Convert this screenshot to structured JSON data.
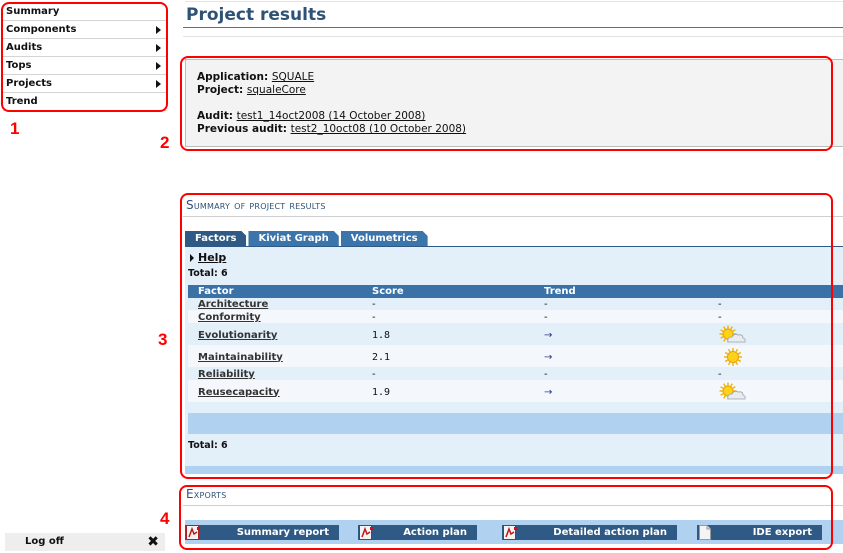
{
  "sidebar": {
    "items": [
      {
        "label": "Summary",
        "has_submenu": false
      },
      {
        "label": "Components",
        "has_submenu": true
      },
      {
        "label": "Audits",
        "has_submenu": true
      },
      {
        "label": "Tops",
        "has_submenu": true
      },
      {
        "label": "Projects",
        "has_submenu": true
      },
      {
        "label": "Trend",
        "has_submenu": false
      }
    ],
    "logoff_label": "Log off",
    "logoff_icon": "close-x-icon"
  },
  "page": {
    "title": "Project results"
  },
  "info": {
    "application_label": "Application:",
    "application_value": "SQUALE",
    "project_label": "Project:",
    "project_value": "squaleCore",
    "audit_label": "Audit:",
    "audit_value": "test1_14oct2008 (14 October 2008)",
    "previous_audit_label": "Previous audit:",
    "previous_audit_value": "test2_10oct08 (10 October 2008)"
  },
  "summary": {
    "title": "Summary of project results",
    "tabs": [
      {
        "label": "Factors",
        "active": true
      },
      {
        "label": "Kiviat Graph",
        "active": false
      },
      {
        "label": "Volumetrics",
        "active": false
      }
    ],
    "help_label": "Help",
    "total_top": "Total: 6",
    "total_bottom": "Total: 6",
    "columns": [
      "Factor",
      "Score",
      "Trend",
      ""
    ],
    "rows": [
      {
        "factor": "Architecture",
        "score": "-",
        "trend": "-",
        "weather": "-",
        "weather_icon": "none"
      },
      {
        "factor": "Conformity",
        "score": "-",
        "trend": "-",
        "weather": "-",
        "weather_icon": "none"
      },
      {
        "factor": "Evolutionarity",
        "score": "1.8",
        "trend": "→",
        "weather": "",
        "weather_icon": "sun-cloud-icon"
      },
      {
        "factor": "Maintainability",
        "score": "2.1",
        "trend": "→",
        "weather": "",
        "weather_icon": "sun-icon"
      },
      {
        "factor": "Reliability",
        "score": "-",
        "trend": "-",
        "weather": "-",
        "weather_icon": "none"
      },
      {
        "factor": "Reusecapacity",
        "score": "1.9",
        "trend": "→",
        "weather": "",
        "weather_icon": "sun-cloud-icon"
      }
    ]
  },
  "exports": {
    "title": "Exports",
    "buttons": [
      {
        "label": "Summary report",
        "icon": "pdf-icon"
      },
      {
        "label": "Action plan",
        "icon": "pdf-icon"
      },
      {
        "label": "Detailed action plan",
        "icon": "pdf-icon"
      },
      {
        "label": "IDE export",
        "icon": "document-icon"
      }
    ]
  },
  "annotations": [
    "1",
    "2",
    "3",
    "4"
  ],
  "colors": {
    "title_blue": "#2e5275",
    "tab_active": "#2e5a85",
    "tab_inactive": "#3b75ab",
    "table_header": "#3a72a8",
    "panel_bg": "#e3eff9",
    "band": "#b0d1ef",
    "annotation_red": "#ff0000"
  }
}
